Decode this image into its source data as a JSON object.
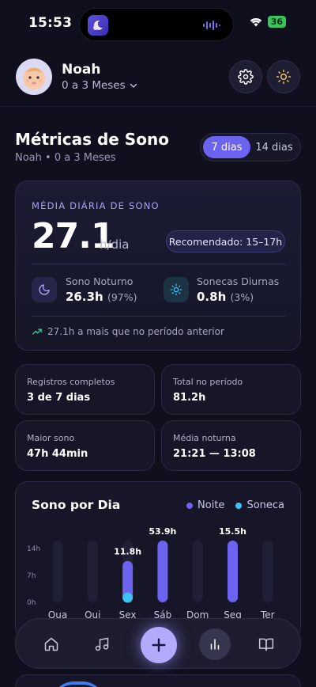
{
  "status_bar": {
    "time": "15:53",
    "battery": "36"
  },
  "profile": {
    "name": "Noah",
    "age_range": "0 a 3 Meses"
  },
  "page": {
    "title": "Métricas de Sono",
    "subtitle": "Noah • 0 a 3 Meses"
  },
  "range_options": [
    "7 dias",
    "14 dias"
  ],
  "selected_range": "7 dias",
  "summary": {
    "label": "MÉDIA DIÁRIA DE SONO",
    "value": "27.1",
    "unit": "h/dia",
    "recommended": "Recomendado: 15–17h",
    "night_label": "Sono Noturno",
    "night_value": "26.3h",
    "night_pct": "(97%)",
    "nap_label": "Sonecas Diurnas",
    "nap_value": "0.8h",
    "nap_pct": "(3%)",
    "trend_text": "27.1h a mais que no período anterior"
  },
  "stats": [
    {
      "label": "Registros completos",
      "value": "3 de 7 dias"
    },
    {
      "label": "Total no período",
      "value": "81.2h"
    },
    {
      "label": "Maior sono",
      "value": "47h 44min"
    },
    {
      "label": "Média noturna",
      "value": "21:21 — 13:08"
    }
  ],
  "colors": {
    "night": "#6c63f0",
    "nap": "#3fc3f5",
    "accent": "#a8a4f5",
    "trend": "#34d399"
  },
  "chart_data": {
    "type": "bar",
    "title": "Sono por Dia",
    "categories": [
      "Qua",
      "Qui",
      "Sex",
      "Sáb",
      "Dom",
      "Seg",
      "Ter"
    ],
    "series": [
      {
        "name": "Noite",
        "values": [
          0,
          0,
          11.0,
          53.9,
          0,
          15.5,
          0
        ]
      },
      {
        "name": "Soneca",
        "values": [
          0,
          0,
          0.8,
          0,
          0,
          0,
          0
        ]
      }
    ],
    "totals": [
      "",
      "",
      "11.8h",
      "53.9h",
      "",
      "15.5h",
      ""
    ],
    "y_ticks": [
      "14h",
      "7h",
      "0h"
    ],
    "ylim": [
      0,
      14
    ]
  },
  "nav": [
    "home-icon",
    "music-icon",
    "add-icon",
    "chart-icon",
    "book-icon"
  ]
}
